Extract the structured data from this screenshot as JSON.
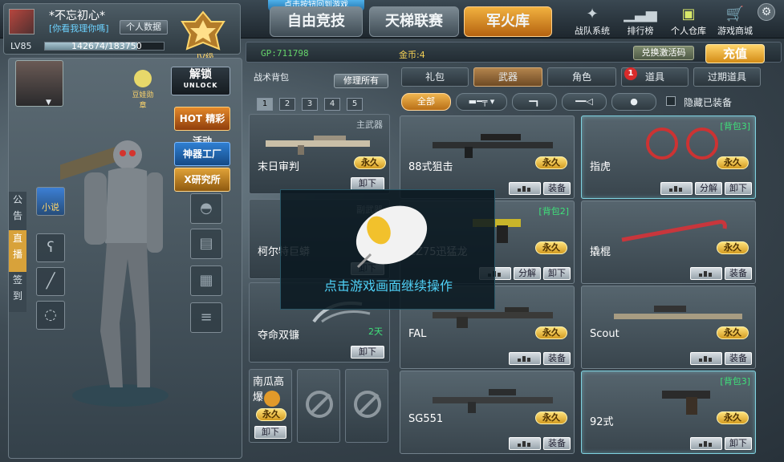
{
  "hint_banner": "点击按钮回到游戏",
  "profile": {
    "name": "*不忘初心*",
    "motto": "[你看我理你嗎]",
    "personal_data_label": "个人数据",
    "level": "LV85",
    "xp_text": "142674/183750",
    "xp_fraction": 0.776,
    "rank_label": "IV级"
  },
  "top_tabs": [
    {
      "label": "自由竞技",
      "active": false
    },
    {
      "label": "天梯联赛",
      "active": false
    },
    {
      "label": "军火库",
      "active": true
    }
  ],
  "system_buttons": [
    {
      "label": "战队系统",
      "icon": "team-icon"
    },
    {
      "label": "排行榜",
      "icon": "ranking-icon"
    },
    {
      "label": "个人仓库",
      "icon": "warehouse-icon",
      "selected": true
    },
    {
      "label": "游戏商城",
      "icon": "shop-cart-icon"
    }
  ],
  "currency": {
    "gp": "GP:711798",
    "gold": "金币:4",
    "redeem_label": "兑换激活码",
    "topup_label": "充值"
  },
  "character_panel": {
    "medal_label": "豆娃勋章",
    "unlock_label": "解锁",
    "unlock_sub": "UNLOCK",
    "promos": [
      "HOT 精彩活动",
      "神器工厂",
      "X研究所"
    ],
    "side_tabs": [
      "公告",
      "直播",
      "签到"
    ],
    "small_slot_label": "小说"
  },
  "loadout": {
    "title": "战术背包",
    "repair_all_label": "修理所有",
    "pages": [
      "1",
      "2",
      "3",
      "4",
      "5"
    ],
    "selected_page": "1",
    "slots": [
      {
        "type": "主武器",
        "name": "末日审判",
        "tag": "永久",
        "duration": "",
        "unequip": "卸下"
      },
      {
        "type": "副武器",
        "name": "柯尔特巨蟒",
        "tag": "",
        "duration": "",
        "unequip": "卸下"
      },
      {
        "type": "",
        "name": "夺命双镰",
        "tag": "",
        "duration": "2天",
        "unequip": "卸下"
      }
    ],
    "grenade": {
      "name": "南瓜高爆",
      "tag": "永久",
      "unequip": "卸下"
    }
  },
  "categories": [
    {
      "label": "礼包",
      "selected": false
    },
    {
      "label": "武器",
      "selected": true
    },
    {
      "label": "角色",
      "selected": false
    },
    {
      "label": "道具",
      "selected": false,
      "badge": "1"
    },
    {
      "label": "过期道具",
      "selected": false
    }
  ],
  "subfilters": {
    "all_label": "全部",
    "icons": [
      "rifle-icon",
      "pistol-icon",
      "knife-icon",
      "grenade-icon"
    ],
    "hide_equipped_label": "隐藏已装备"
  },
  "items": [
    {
      "name": "88式狙击",
      "pack": "",
      "tag": "永久",
      "actions": [
        "装备"
      ],
      "highlight": false
    },
    {
      "name": "指虎",
      "pack": "[背包3]",
      "tag": "永久",
      "actions": [
        "分解",
        "卸下"
      ],
      "highlight": true
    },
    {
      "name": "CZ75迅猛龙",
      "pack": "[背包2]",
      "tag": "永久",
      "actions": [
        "分解",
        "卸下"
      ],
      "highlight": false
    },
    {
      "name": "撬棍",
      "pack": "",
      "tag": "永久",
      "actions": [
        "装备"
      ],
      "highlight": false
    },
    {
      "name": "FAL",
      "pack": "",
      "tag": "永久",
      "actions": [
        "装备"
      ],
      "highlight": false
    },
    {
      "name": "Scout",
      "pack": "",
      "tag": "永久",
      "actions": [
        "装备"
      ],
      "highlight": false
    },
    {
      "name": "SG551",
      "pack": "",
      "tag": "永久",
      "actions": [
        "装备"
      ],
      "highlight": false
    },
    {
      "name": "92式",
      "pack": "[背包3]",
      "tag": "永久",
      "actions": [
        "卸下"
      ],
      "highlight": true
    }
  ],
  "overlay": {
    "text": "点击游戏画面继续操作"
  },
  "colors": {
    "accent_orange": "#f0b54f",
    "gp_green": "#65d36a",
    "gold_yellow": "#f3cf55",
    "overlay_text": "#4fd1f7"
  }
}
